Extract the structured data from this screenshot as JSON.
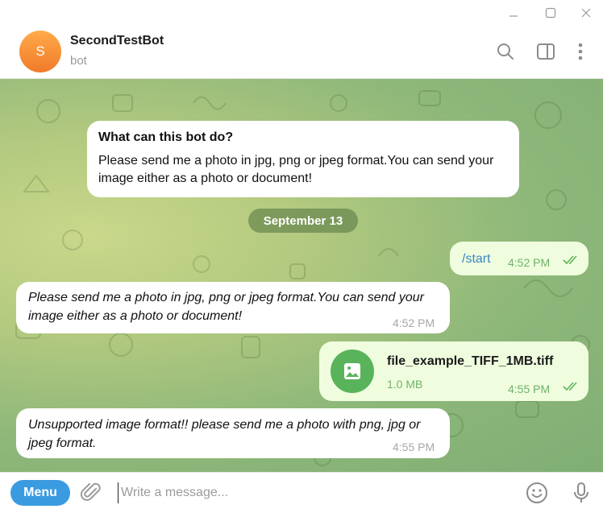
{
  "header": {
    "avatar_letter": "S",
    "title": "SecondTestBot",
    "status": "bot"
  },
  "intro": {
    "title": "What can this bot do?",
    "body": "Please send me a photo in jpg, png or jpeg format.You can send your image either as a photo or document!"
  },
  "date_separator": "September 13",
  "messages": [
    {
      "direction": "outgoing",
      "text": "/start",
      "time": "4:52 PM",
      "read": true
    },
    {
      "direction": "incoming",
      "text": "Please send me a photo in jpg, png or jpeg format.You can send your image either as a photo or document!",
      "time": "4:52 PM"
    },
    {
      "direction": "outgoing",
      "type": "file",
      "file_name": "file_example_TIFF_1MB.tiff",
      "file_size": "1.0 MB",
      "time": "4:55 PM",
      "read": true
    },
    {
      "direction": "incoming",
      "text": "Unsupported image format!! please send me a photo with png, jpg or jpeg format.",
      "time": "4:55 PM"
    }
  ],
  "input": {
    "menu_label": "Menu",
    "placeholder": "Write a message..."
  },
  "colors": {
    "accent": "#3a9be0",
    "outgoing_bubble": "#effdde",
    "file_icon": "#59b35a",
    "avatar": "#f5913a"
  },
  "icons": [
    "minimize-icon",
    "maximize-icon",
    "close-icon",
    "search-icon",
    "sidebar-toggle-icon",
    "more-vertical-icon",
    "image-file-icon",
    "paperclip-icon",
    "emoji-icon",
    "microphone-icon",
    "double-check-icon"
  ]
}
